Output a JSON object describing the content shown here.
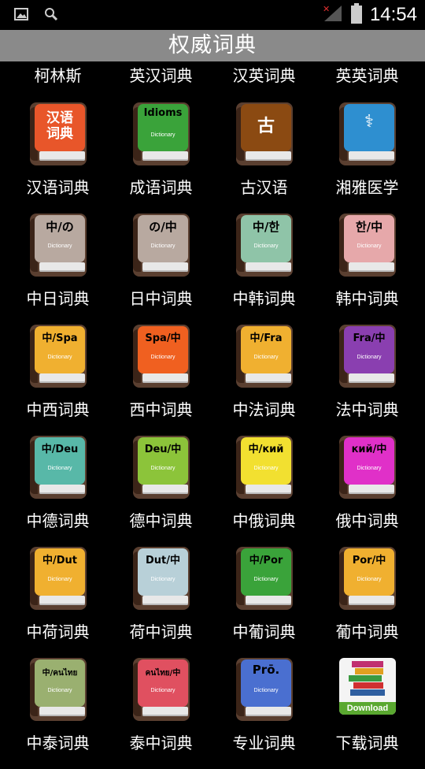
{
  "status_bar": {
    "time": "14:54",
    "icons": [
      "image-icon",
      "search-icon",
      "no-signal-icon",
      "battery-icon"
    ]
  },
  "header": {
    "title": "权威词典"
  },
  "partial_row": [
    "柯林斯",
    "英汉词典",
    "汉英词典",
    "英英词典"
  ],
  "items": [
    {
      "label": "汉语词典",
      "cover": "汉语\n词典",
      "sub": "",
      "color": "#e8562a",
      "icon": "dictionary-icon"
    },
    {
      "label": "成语词典",
      "cover": "Idioms",
      "sub": "Dictionary",
      "color": "#3aa33a",
      "icon": "dictionary-icon"
    },
    {
      "label": "古汉语",
      "cover": "古",
      "sub": "",
      "color": "#8b4a12",
      "icon": "dictionary-icon"
    },
    {
      "label": "湘雅医学",
      "cover": "⚕",
      "sub": "",
      "color": "#2e8fd0",
      "icon": "dictionary-icon"
    },
    {
      "label": "中日词典",
      "cover": "中/の",
      "sub": "Dictionary",
      "color": "#b8a9a0",
      "icon": "dictionary-icon"
    },
    {
      "label": "日中词典",
      "cover": "の/中",
      "sub": "Dictionary",
      "color": "#b8a9a0",
      "icon": "dictionary-icon"
    },
    {
      "label": "中韩词典",
      "cover": "中/한",
      "sub": "Dictionary",
      "color": "#8fc4a8",
      "icon": "dictionary-icon"
    },
    {
      "label": "韩中词典",
      "cover": "한/中",
      "sub": "Dictionary",
      "color": "#e6a8aa",
      "icon": "dictionary-icon"
    },
    {
      "label": "中西词典",
      "cover": "中/Spa",
      "sub": "Dictionary",
      "color": "#f0b030",
      "icon": "dictionary-icon"
    },
    {
      "label": "西中词典",
      "cover": "Spa/中",
      "sub": "Dictionary",
      "color": "#f06020",
      "icon": "dictionary-icon"
    },
    {
      "label": "中法词典",
      "cover": "中/Fra",
      "sub": "Dictionary",
      "color": "#f0b030",
      "icon": "dictionary-icon"
    },
    {
      "label": "法中词典",
      "cover": "Fra/中",
      "sub": "Dictionary",
      "color": "#8a3fb0",
      "icon": "dictionary-icon"
    },
    {
      "label": "中德词典",
      "cover": "中/Deu",
      "sub": "Dictionary",
      "color": "#58b8a8",
      "icon": "dictionary-icon"
    },
    {
      "label": "德中词典",
      "cover": "Deu/中",
      "sub": "Dictionary",
      "color": "#8cc43a",
      "icon": "dictionary-icon"
    },
    {
      "label": "中俄词典",
      "cover": "中/кий",
      "sub": "Dictionary",
      "color": "#f2e030",
      "icon": "dictionary-icon"
    },
    {
      "label": "俄中词典",
      "cover": "кий/中",
      "sub": "Dictionary",
      "color": "#e030c8",
      "icon": "dictionary-icon"
    },
    {
      "label": "中荷词典",
      "cover": "中/Dut",
      "sub": "Dictionary",
      "color": "#f0b030",
      "icon": "dictionary-icon"
    },
    {
      "label": "荷中词典",
      "cover": "Dut/中",
      "sub": "Dictionary",
      "color": "#b8d0d8",
      "icon": "dictionary-icon"
    },
    {
      "label": "中葡词典",
      "cover": "中/Por",
      "sub": "Dictionary",
      "color": "#3aa33a",
      "icon": "dictionary-icon"
    },
    {
      "label": "葡中词典",
      "cover": "Por/中",
      "sub": "Dictionary",
      "color": "#f0b030",
      "icon": "dictionary-icon"
    },
    {
      "label": "中泰词典",
      "cover": "中/คนไทย",
      "sub": "Dictionary",
      "color": "#9ab070",
      "icon": "dictionary-icon"
    },
    {
      "label": "泰中词典",
      "cover": "คนไทย/中",
      "sub": "Dictionary",
      "color": "#e05060",
      "icon": "dictionary-icon"
    },
    {
      "label": "专业词典",
      "cover": "Prō.",
      "sub": "Dictionary",
      "color": "#4a6fd0",
      "icon": "dictionary-icon"
    },
    {
      "label": "下载词典",
      "cover": "Download",
      "sub": "",
      "color": "#5aa830",
      "icon": "download-books-icon"
    }
  ]
}
